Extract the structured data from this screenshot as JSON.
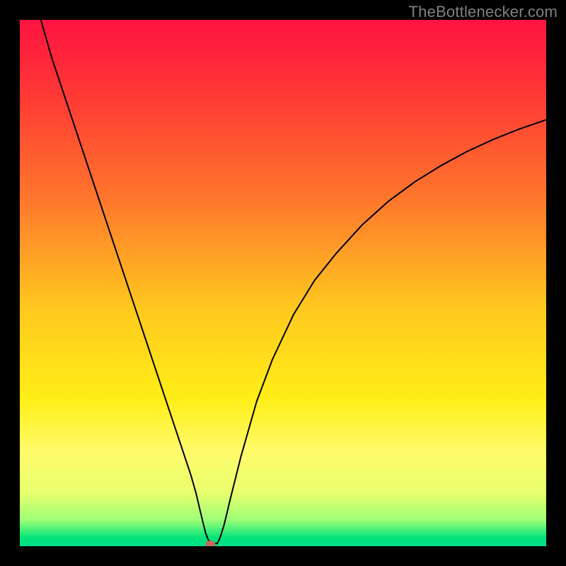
{
  "watermark": "TheBottlenecker.com",
  "chart_data": {
    "type": "line",
    "title": "",
    "xlabel": "",
    "ylabel": "",
    "xlim": [
      0,
      100
    ],
    "ylim": [
      0,
      100
    ],
    "grid": false,
    "legend": false,
    "background_gradient": {
      "stops": [
        {
          "offset": 0.0,
          "color": "#ff1342"
        },
        {
          "offset": 0.15,
          "color": "#ff3b34"
        },
        {
          "offset": 0.35,
          "color": "#ff7a2b"
        },
        {
          "offset": 0.55,
          "color": "#ffc91f"
        },
        {
          "offset": 0.72,
          "color": "#ffee17"
        },
        {
          "offset": 0.82,
          "color": "#fffb6b"
        },
        {
          "offset": 0.9,
          "color": "#e7ff6e"
        },
        {
          "offset": 0.95,
          "color": "#9dff76"
        },
        {
          "offset": 0.985,
          "color": "#00e37a"
        },
        {
          "offset": 1.0,
          "color": "#00e088"
        }
      ]
    },
    "series": [
      {
        "name": "bottleneck-curve",
        "stroke": "#000000",
        "stroke_width": 2,
        "x": [
          4.0,
          6.0,
          9.0,
          12.0,
          15.0,
          18.0,
          21.0,
          24.0,
          27.0,
          29.0,
          31.0,
          32.5,
          33.5,
          34.2,
          34.8,
          35.3,
          35.8,
          36.5,
          37.0,
          37.5,
          38.0,
          38.8,
          40.0,
          42.0,
          45.0,
          48.0,
          52.0,
          56.0,
          60.0,
          65.0,
          70.0,
          75.0,
          80.0,
          85.0,
          90.0,
          95.0,
          100.0
        ],
        "values": [
          100.0,
          93.0,
          84.0,
          75.0,
          66.0,
          57.0,
          48.0,
          39.0,
          30.0,
          24.0,
          18.0,
          13.5,
          10.0,
          7.0,
          4.5,
          2.5,
          1.2,
          0.5,
          0.5,
          0.5,
          1.5,
          4.0,
          9.0,
          17.0,
          27.5,
          35.5,
          44.0,
          50.5,
          55.5,
          61.0,
          65.5,
          69.2,
          72.3,
          75.0,
          77.3,
          79.3,
          81.0
        ]
      }
    ],
    "marker": {
      "x": 36.2,
      "y": 0.4,
      "fill": "#c26a5a",
      "rx": 7,
      "ry": 5
    }
  }
}
